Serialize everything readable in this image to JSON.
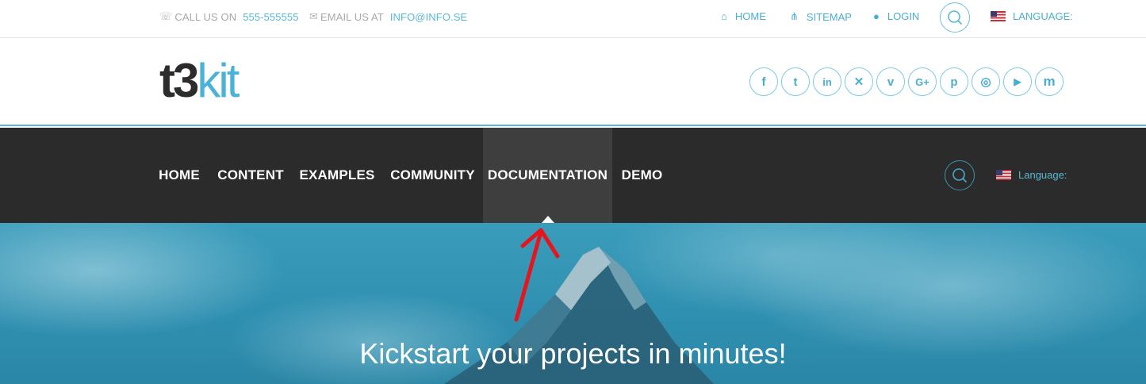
{
  "topbar": {
    "call_label": "CALL US ON",
    "call_value": "555-555555",
    "email_label": "EMAIL US AT",
    "email_value": "INFO@INFO.SE",
    "links": [
      {
        "label": "HOME",
        "icon": "home-icon"
      },
      {
        "label": "SITEMAP",
        "icon": "sitemap-icon"
      },
      {
        "label": "LOGIN",
        "icon": "user-icon"
      }
    ],
    "language_label": "LANGUAGE:"
  },
  "header": {
    "logo_dark": "t3",
    "logo_light": "kit",
    "social": [
      {
        "icon": "facebook-icon",
        "glyph": "f"
      },
      {
        "icon": "twitter-icon",
        "glyph": "t"
      },
      {
        "icon": "linkedin-icon",
        "glyph": "in"
      },
      {
        "icon": "xing-icon",
        "glyph": "✕"
      },
      {
        "icon": "vimeo-icon",
        "glyph": "v"
      },
      {
        "icon": "google-plus-icon",
        "glyph": "G+"
      },
      {
        "icon": "pinterest-icon",
        "glyph": "p"
      },
      {
        "icon": "instagram-icon",
        "glyph": "◎"
      },
      {
        "icon": "youtube-icon",
        "glyph": "▶"
      },
      {
        "icon": "medium-icon",
        "glyph": "m"
      }
    ]
  },
  "nav": {
    "items": [
      {
        "label": "HOME"
      },
      {
        "label": "CONTENT"
      },
      {
        "label": "EXAMPLES"
      },
      {
        "label": "COMMUNITY"
      },
      {
        "label": "DOCUMENTATION",
        "active": true
      },
      {
        "label": "DEMO"
      }
    ],
    "language_label": "Language:"
  },
  "hero": {
    "title": "Kickstart your projects in minutes!"
  },
  "colors": {
    "accent": "#4aaed0",
    "nav_bg": "#2b2b2b",
    "nav_active_bg": "#3e3e3e",
    "annotation": "#e8141c"
  }
}
